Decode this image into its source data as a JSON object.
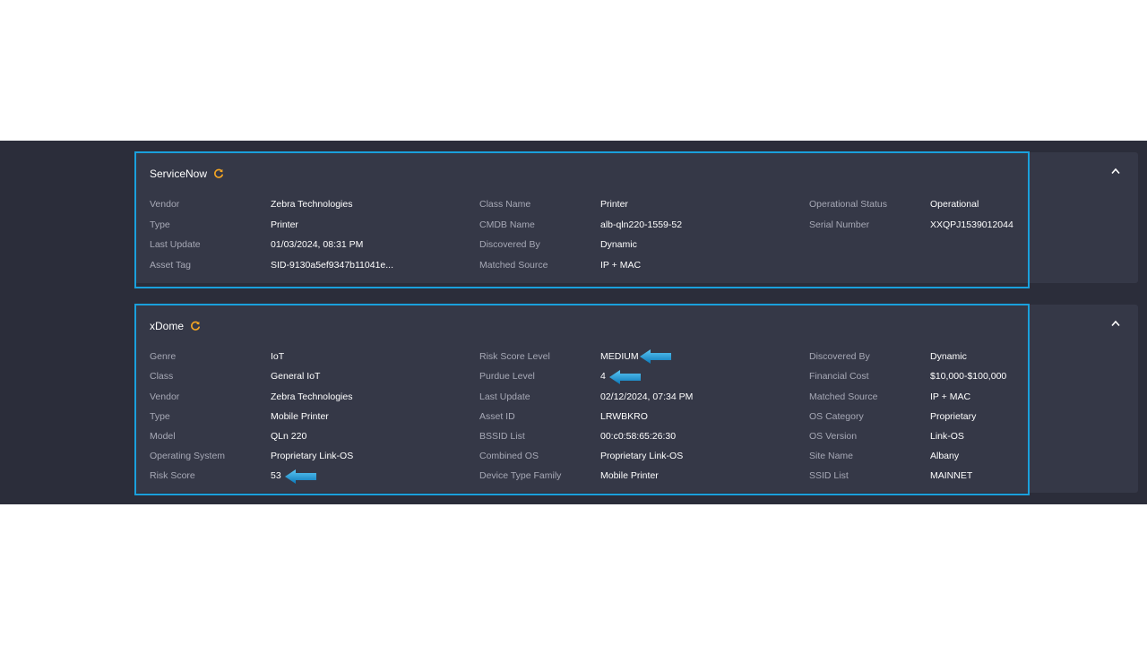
{
  "servicenow": {
    "title": "ServiceNow",
    "rows": [
      {
        "l1": "Vendor",
        "v1": "Zebra Technologies",
        "l2": "Class Name",
        "v2": "Printer",
        "l3": "Operational Status",
        "v3": "Operational"
      },
      {
        "l1": "Type",
        "v1": "Printer",
        "l2": "CMDB Name",
        "v2": "alb-qln220-1559-52",
        "l3": "Serial Number",
        "v3": "XXQPJ1539012044"
      },
      {
        "l1": "Last Update",
        "v1": "01/03/2024, 08:31 PM",
        "l2": "Discovered By",
        "v2": "Dynamic",
        "l3": "",
        "v3": ""
      },
      {
        "l1": "Asset Tag",
        "v1": "SID-9130a5ef9347b11041e...",
        "l2": "Matched Source",
        "v2": "IP + MAC",
        "l3": "",
        "v3": ""
      }
    ]
  },
  "xdome": {
    "title": "xDome",
    "rows": [
      {
        "l1": "Genre",
        "v1": "IoT",
        "l2": "Risk Score Level",
        "v2": "MEDIUM",
        "l3": "Discovered By",
        "v3": "Dynamic"
      },
      {
        "l1": "Class",
        "v1": "General IoT",
        "l2": "Purdue Level",
        "v2": "4",
        "l3": "Financial Cost",
        "v3": "$10,000-$100,000"
      },
      {
        "l1": "Vendor",
        "v1": "Zebra Technologies",
        "l2": "Last Update",
        "v2": "02/12/2024, 07:34 PM",
        "l3": "Matched Source",
        "v3": "IP + MAC"
      },
      {
        "l1": "Type",
        "v1": "Mobile Printer",
        "l2": "Asset ID",
        "v2": "LRWBKRO",
        "l3": "OS Category",
        "v3": "Proprietary"
      },
      {
        "l1": "Model",
        "v1": "QLn 220",
        "l2": "BSSID List",
        "v2": "00:c0:58:65:26:30",
        "l3": "OS Version",
        "v3": "Link-OS"
      },
      {
        "l1": "Operating System",
        "v1": "Proprietary Link-OS",
        "l2": "Combined OS",
        "v2": "Proprietary Link-OS",
        "l3": "Site Name",
        "v3": "Albany"
      },
      {
        "l1": "Risk Score",
        "v1": "53",
        "l2": "Device Type Family",
        "v2": "Mobile Printer",
        "l3": "SSID List",
        "v3": "MAINNET"
      }
    ]
  },
  "icons": {
    "refresh": "refresh-icon",
    "collapse": "chevron-up-icon",
    "callout": "arrow-left-icon"
  },
  "colors": {
    "band": "#2b2d3a",
    "card": "#353847",
    "highlight": "#1aa0dc",
    "refresh_icon": "#f5a623",
    "label": "#a7a9b6",
    "value": "#ffffff"
  }
}
